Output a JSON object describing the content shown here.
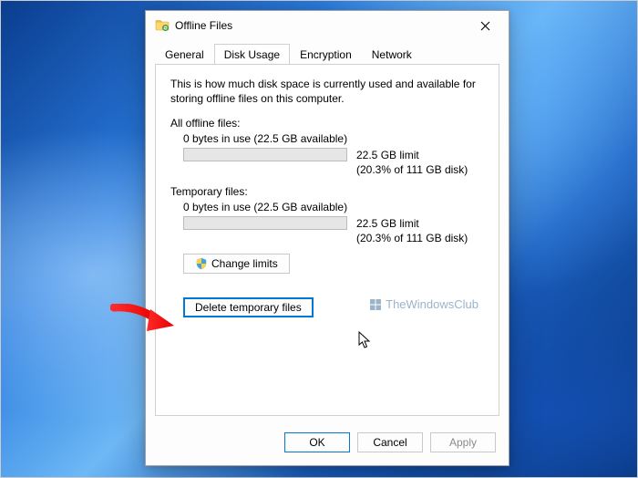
{
  "window": {
    "title": "Offline Files"
  },
  "tabs": [
    {
      "label": "General"
    },
    {
      "label": "Disk Usage"
    },
    {
      "label": "Encryption"
    },
    {
      "label": "Network"
    }
  ],
  "active_tab_index": 1,
  "disk_usage": {
    "description": "This is how much disk space is currently used and available for storing offline files on this computer.",
    "all_offline": {
      "label": "All offline files:",
      "usage": "0 bytes in use (22.5 GB available)",
      "limit": "22.5 GB limit",
      "percent": "(20.3% of 111 GB disk)"
    },
    "temporary": {
      "label": "Temporary files:",
      "usage": "0 bytes in use (22.5 GB available)",
      "limit": "22.5 GB limit",
      "percent": "(20.3% of 111 GB disk)"
    },
    "change_limits_label": "Change limits",
    "delete_temp_label": "Delete temporary files"
  },
  "buttons": {
    "ok": "OK",
    "cancel": "Cancel",
    "apply": "Apply"
  },
  "watermark": "TheWindowsClub"
}
